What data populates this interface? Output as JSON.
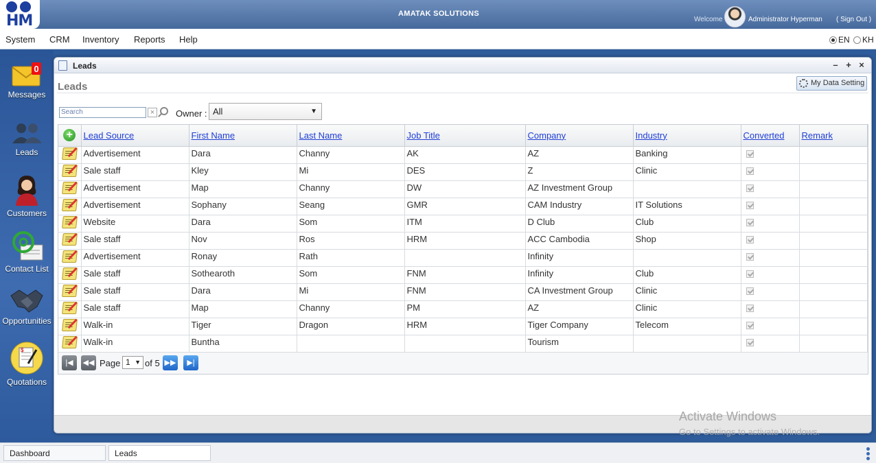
{
  "header": {
    "logo_text": "HM",
    "app_title": "AMATAK SOLUTIONS",
    "welcome": "Welcome",
    "username": "Administrator Hyperman",
    "sign_out": "( Sign Out )"
  },
  "menu": [
    "System",
    "CRM",
    "Inventory",
    "Reports",
    "Help"
  ],
  "languages": [
    {
      "label": "EN",
      "selected": true
    },
    {
      "label": "KH",
      "selected": false
    }
  ],
  "sidebar": [
    {
      "label": "Messages",
      "icon": "mail-icon",
      "badge": "0"
    },
    {
      "label": "Leads",
      "icon": "leads-icon"
    },
    {
      "label": "Customers",
      "icon": "customer-icon"
    },
    {
      "label": "Contact List",
      "icon": "contact-list-icon"
    },
    {
      "label": "Opportunities",
      "icon": "handshake-icon"
    },
    {
      "label": "Quotations",
      "icon": "quotation-icon"
    }
  ],
  "window": {
    "title": "Leads",
    "heading": "Leads",
    "my_data_setting": "My Data Setting",
    "search_placeholder": "Search",
    "owner_label": "Owner :",
    "owner_value": "All"
  },
  "table": {
    "columns": [
      "Lead Source",
      "First Name",
      "Last Name",
      "Job Title",
      "Company",
      "Industry",
      "Converted",
      "Remark"
    ],
    "rows": [
      [
        "Advertisement",
        "Dara",
        "Channy",
        "AK",
        "AZ",
        "Banking"
      ],
      [
        "Sale staff",
        "Kley",
        "Mi",
        "DES",
        "Z",
        "Clinic"
      ],
      [
        "Advertisement",
        "Map",
        "Channy",
        "DW",
        "AZ Investment Group",
        ""
      ],
      [
        "Advertisement",
        "Sophany",
        "Seang",
        "GMR",
        "CAM Industry",
        "IT Solutions"
      ],
      [
        "Website",
        "Dara",
        "Som",
        "ITM",
        "D Club",
        "Club"
      ],
      [
        "Sale staff",
        "Nov",
        "Ros",
        "HRM",
        "ACC Cambodia",
        "Shop"
      ],
      [
        "Advertisement",
        "Ronay",
        "Rath",
        "",
        "Infinity",
        ""
      ],
      [
        "Sale staff",
        "Sothearoth",
        "Som",
        "FNM",
        "Infinity",
        "Club"
      ],
      [
        "Sale staff",
        "Dara",
        "Mi",
        "FNM",
        "CA Investment Group",
        "Clinic"
      ],
      [
        "Sale staff",
        "Map",
        "Channy",
        "PM",
        "AZ",
        "Clinic"
      ],
      [
        "Walk-in",
        "Tiger",
        "Dragon",
        "HRM",
        "Tiger Company",
        "Telecom"
      ],
      [
        "Walk-in",
        "Buntha",
        "",
        "",
        "Tourism",
        ""
      ]
    ]
  },
  "pager": {
    "page_label": "Page",
    "page_value": "1",
    "of_label": "of 5"
  },
  "watermark": {
    "line1": "Activate Windows",
    "line2": "Go to Settings to activate Windows."
  },
  "taskbar": {
    "tabs": [
      "Dashboard",
      "Leads"
    ]
  },
  "colors": {
    "header_blue": "#46699c",
    "sidebar_blue": "#2e5b99",
    "link_blue": "#1f3fd6"
  }
}
